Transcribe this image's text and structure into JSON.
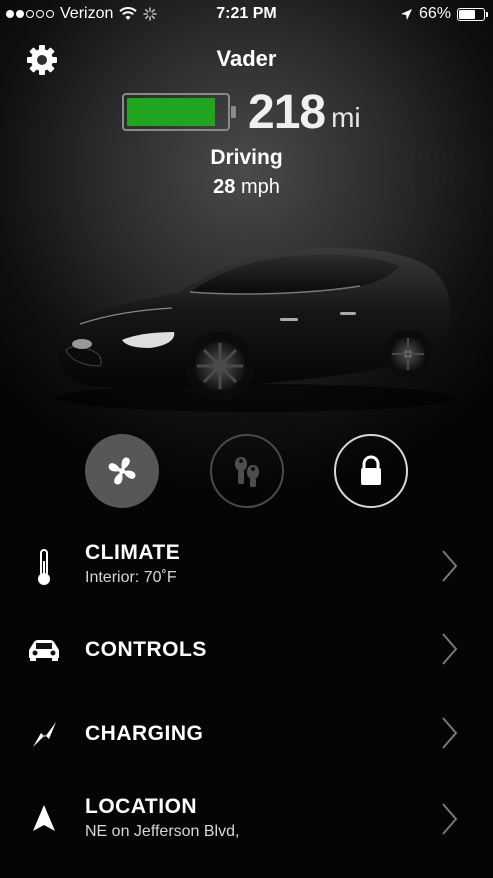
{
  "status_bar": {
    "carrier": "Verizon",
    "time": "7:21 PM",
    "battery_percent": "66%",
    "battery_level": 0.66,
    "signal_bars_filled": 2,
    "signal_bars_total": 5,
    "icons": [
      "wifi-icon",
      "activity-spinner-icon",
      "location-arrow-icon",
      "battery-icon"
    ]
  },
  "header": {
    "vehicle_name": "Vader",
    "range_value": "218",
    "range_unit": "mi",
    "battery_level": 0.9,
    "battery_color": "#1fa51f",
    "drive_state": "Driving",
    "speed_value": "28",
    "speed_unit": "mph",
    "settings_icon": "gear-icon"
  },
  "quick_actions": [
    {
      "name": "climate-fan-button",
      "icon": "fan-icon",
      "active": true
    },
    {
      "name": "keys-button",
      "icon": "keys-icon",
      "active": false
    },
    {
      "name": "lock-button",
      "icon": "lock-icon",
      "active": true
    }
  ],
  "menu": {
    "climate": {
      "title": "CLIMATE",
      "subtitle": "Interior: 70˚F",
      "icon": "thermometer-icon"
    },
    "controls": {
      "title": "CONTROLS",
      "icon": "car-icon"
    },
    "charging": {
      "title": "CHARGING",
      "icon": "lightning-icon"
    },
    "location": {
      "title": "LOCATION",
      "subtitle": "NE on Jefferson Blvd,",
      "icon": "navigation-arrow-icon"
    }
  },
  "colors": {
    "accent_green": "#1fa51f",
    "background": "#000000"
  }
}
